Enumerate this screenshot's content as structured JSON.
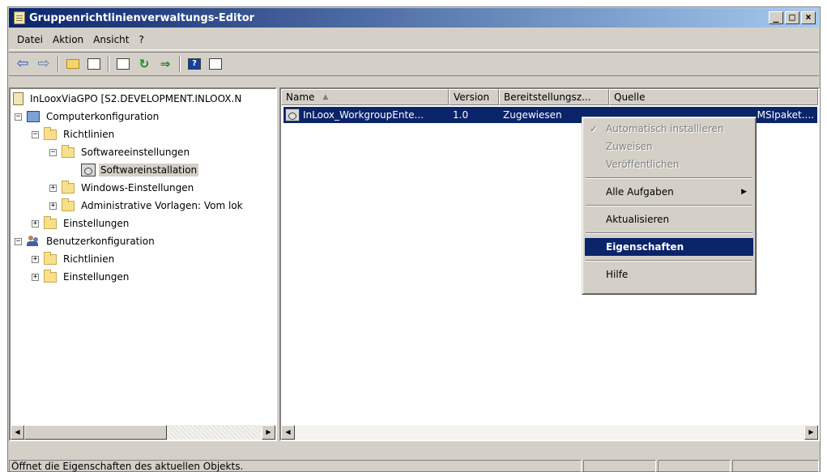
{
  "window": {
    "title": "Gruppenrichtlinienverwaltungs-Editor",
    "buttons": {
      "minimize": "_",
      "maximize": "□",
      "close": "×"
    }
  },
  "menu": [
    {
      "label": "Datei"
    },
    {
      "label": "Aktion"
    },
    {
      "label": "Ansicht"
    },
    {
      "label": "?"
    }
  ],
  "toolbar": {
    "icons": [
      "back-icon",
      "forward-icon",
      "up-folder-icon",
      "show-hide-tree-icon",
      "properties-icon",
      "refresh-icon",
      "export-list-icon",
      "help-icon",
      "console-view-icon"
    ]
  },
  "tree": [
    {
      "label": "InLooxViaGPO [S2.DEVELOPMENT.INLOOX.N",
      "expander": "",
      "icon": "gpo-doc-icon"
    },
    {
      "label": "Computerkonfiguration",
      "expander": "−",
      "icon": "computer-icon"
    },
    {
      "label": "Richtlinien",
      "expander": "−",
      "icon": "folder-icon"
    },
    {
      "label": "Softwareeinstellungen",
      "expander": "−",
      "icon": "folder-icon"
    },
    {
      "label": "Softwareinstallation",
      "expander": "",
      "icon": "software-package-icon",
      "selected": true
    },
    {
      "label": "Windows-Einstellungen",
      "expander": "+",
      "icon": "folder-icon"
    },
    {
      "label": "Administrative Vorlagen: Vom lok",
      "expander": "+",
      "icon": "folder-icon"
    },
    {
      "label": "Einstellungen",
      "expander": "+",
      "icon": "folder-icon"
    },
    {
      "label": "Benutzerkonfiguration",
      "expander": "−",
      "icon": "users-icon"
    },
    {
      "label": "Richtlinien",
      "expander": "+",
      "icon": "folder-icon"
    },
    {
      "label": "Einstellungen",
      "expander": "+",
      "icon": "folder-icon"
    }
  ],
  "list": {
    "columns": [
      {
        "label": "Name",
        "sort": "▲"
      },
      {
        "label": "Version"
      },
      {
        "label": "Bereitstellungsz..."
      },
      {
        "label": "Quelle"
      }
    ],
    "rows": [
      {
        "name": "InLoox_WorkgroupEnte...",
        "version": "1.0",
        "deployment": "Zugewiesen",
        "source": "MSIpaket...."
      }
    ]
  },
  "context_menu": {
    "items": [
      {
        "label": "Automatisch installieren",
        "disabled": true,
        "checked": true
      },
      {
        "label": "Zuweisen",
        "disabled": true
      },
      {
        "label": "Veröffentlichen",
        "disabled": true
      },
      {
        "separator": true
      },
      {
        "label": "Alle Aufgaben",
        "submenu": "▶"
      },
      {
        "separator": true
      },
      {
        "label": "Aktualisieren"
      },
      {
        "separator": true
      },
      {
        "label": "Eigenschaften",
        "highlighted": true,
        "bold": true
      },
      {
        "separator": true
      },
      {
        "label": "Hilfe"
      }
    ],
    "checkmark": "✓"
  },
  "statusbar": {
    "text": "Öffnet die Eigenschaften des aktuellen Objekts."
  },
  "colors": {
    "selection": "#0a246a",
    "titlebar_start": "#0a246a",
    "titlebar_end": "#a6caf0",
    "face": "#d4d0c8"
  }
}
